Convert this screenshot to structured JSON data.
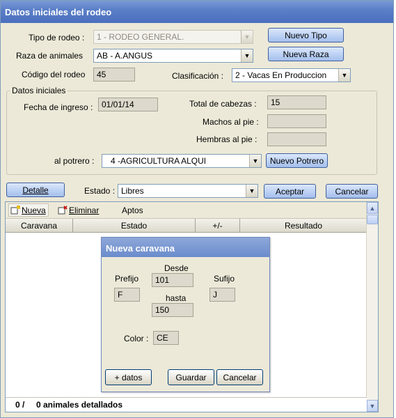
{
  "window": {
    "title": "Datos iniciales del rodeo"
  },
  "form": {
    "tipo_label": "Tipo de rodeo :",
    "tipo_value": "1 - RODEO GENERAL.",
    "raza_label": "Raza de animales",
    "raza_value": "AB - A.ANGUS",
    "codigo_label": "Código del rodeo",
    "codigo_value": "45",
    "clasificacion_label": "Clasificación :",
    "clasificacion_value": "2 - Vacas En Produccion"
  },
  "buttons": {
    "nuevo_tipo": "Nuevo Tipo",
    "nueva_raza": "Nueva Raza",
    "nuevo_potrero": "Nuevo Potrero",
    "detalle": "Detalle",
    "aceptar": "Aceptar",
    "cancelar": "Cancelar"
  },
  "datos_iniciales": {
    "title": "Datos iniciales",
    "fecha_label": "Fecha de ingreso :",
    "fecha_value": "01/01/14",
    "total_label": "Total de cabezas :",
    "total_value": "15",
    "machos_label": "Machos al pie :",
    "machos_value": "",
    "hembras_label": "Hembras al pie :",
    "hembras_value": "",
    "potrero_label": "al potrero :",
    "potrero_value": "4 -AGRICULTURA ALQUI"
  },
  "estado": {
    "label": "Estado :",
    "value": "Libres"
  },
  "grid": {
    "toolbar": {
      "nueva": "Nueva",
      "eliminar": "Eliminar",
      "aptos": "Aptos"
    },
    "columns": [
      "Caravana",
      "Estado",
      "+/-",
      "Resultado"
    ],
    "footer_count": "0 /",
    "footer_text": "0 animales detallados"
  },
  "dialog": {
    "title": "Nueva caravana",
    "prefijo_label": "Prefijo",
    "prefijo_value": "F",
    "desde_label": "Desde",
    "desde_value": "101",
    "hasta_label": "hasta",
    "hasta_value": "150",
    "sufijo_label": "Sufijo",
    "sufijo_value": "J",
    "color_label": "Color :",
    "color_value": "CE",
    "mas_datos": "+ datos",
    "guardar": "Guardar",
    "cancelar": "Cancelar"
  },
  "colors": {
    "title_bar": "#5b7fc8",
    "dialog_title": "#6a8ccc",
    "window_bg": "#ece9d8"
  }
}
